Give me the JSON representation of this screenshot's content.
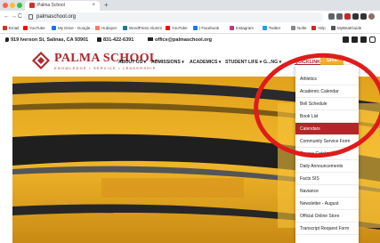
{
  "browser": {
    "tab_title": "Palma School",
    "tab_close": "×",
    "new_tab": "+",
    "nav_back": "←",
    "nav_forward": "→",
    "nav_reload": "C",
    "url": "palmaschool.org"
  },
  "bookmarks": [
    {
      "label": "Email",
      "color": "#d93025"
    },
    {
      "label": "YouTube",
      "color": "#ff0000"
    },
    {
      "label": "My Drive - Google...",
      "color": "#1a73e8"
    },
    {
      "label": "Hubspot",
      "color": "#ff7a59"
    },
    {
      "label": "WordPress Alumni",
      "color": "#21759b"
    },
    {
      "label": "YouTube",
      "color": "#ff0000"
    },
    {
      "label": "| Facebook",
      "color": "#1877f2"
    },
    {
      "label": "Instagram",
      "color": "#c13584"
    },
    {
      "label": "Twitter",
      "color": "#1da1f2"
    },
    {
      "label": "Nolte",
      "color": "#888888"
    },
    {
      "label": "Yelp",
      "color": "#d32323"
    },
    {
      "label": "MyBeatGuide",
      "color": "#555555"
    }
  ],
  "site": {
    "address": "919 Iverson St, Salinas, CA 93901",
    "phone": "831-422-6391",
    "email": "office@palmaschool.org",
    "brand": "PALMA SCHOOL",
    "tagline": "KNOWLEDGE • SERVICE • LEADERSHIP",
    "give_label": "GIVE",
    "brand_color": "#b2262a",
    "accent_color": "#f2b134"
  },
  "menu": [
    {
      "label": "ABOUT US ▾"
    },
    {
      "label": "ADMISSIONS ▾"
    },
    {
      "label": "ACADEMICS ▾"
    },
    {
      "label": "STUDENT LIFE ▾"
    },
    {
      "label": "G...NG ▾"
    },
    {
      "label": "QUICKLINKS ▾"
    }
  ],
  "quicklinks": [
    "Athletics",
    "Academic Calendar",
    "Bell Schedule",
    "Book List",
    "Calendars",
    "Community Service Form",
    "Course Catalog",
    "Daily Announcements",
    "Facts SIS",
    "Naviance",
    "Newsletter - August",
    "Official Online Store",
    "Transcript Request Form"
  ],
  "highlighted_item": "Calendars",
  "annotation_color": "#e01b1b"
}
